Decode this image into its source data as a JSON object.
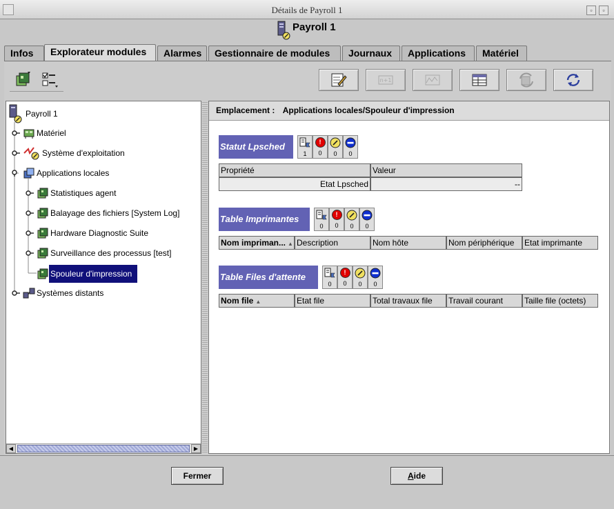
{
  "window": {
    "title": "Détails de Payroll 1",
    "host_name": "Payroll 1"
  },
  "tabs": [
    {
      "label": "Infos"
    },
    {
      "label": "Explorateur modules"
    },
    {
      "label": "Alarmes"
    },
    {
      "label": "Gestionnaire de modules"
    },
    {
      "label": "Journaux"
    },
    {
      "label": "Applications"
    },
    {
      "label": "Matériel"
    }
  ],
  "active_tab": "Explorateur modules",
  "tree": {
    "root": "Payroll 1",
    "items": [
      {
        "label": "Matériel"
      },
      {
        "label": "Système d'exploitation"
      },
      {
        "label": "Applications locales"
      },
      {
        "label": "Statistiques agent"
      },
      {
        "label": "Balayage des fichiers [System Log]"
      },
      {
        "label": "Hardware Diagnostic Suite"
      },
      {
        "label": "Surveillance des processus [test]"
      },
      {
        "label": "Spouleur d'impression"
      },
      {
        "label": "Systèmes distants"
      }
    ],
    "selected": "Spouleur d'impression"
  },
  "location": {
    "label": "Emplacement :",
    "value": "Applications locales/Spouleur d'impression"
  },
  "sections": [
    {
      "title": "Statut Lpsched",
      "counts": [
        "1",
        "0",
        "0",
        "0"
      ],
      "columns": [
        "Propriété",
        "Valeur"
      ],
      "rows": [
        [
          "Etat Lpsched",
          "--"
        ]
      ]
    },
    {
      "title": "Table Imprimantes",
      "counts": [
        "0",
        "0",
        "0",
        "0"
      ],
      "columns": [
        "Nom impriman...",
        "Description",
        "Nom hôte",
        "Nom périphérique",
        "Etat imprimante"
      ]
    },
    {
      "title": "Table Files d'attente",
      "counts": [
        "0",
        "0",
        "0",
        "0"
      ],
      "columns": [
        "Nom file",
        "Etat file",
        "Total travaux file",
        "Travail courant",
        "Taille file (octets)"
      ]
    }
  ],
  "buttons": {
    "close": "Fermer",
    "help_mnemonic": "A",
    "help_rest": "ide"
  },
  "colors": {
    "selection": "#10107a",
    "section_header": "#6262b4",
    "critical": "#e00000",
    "warning": "#f0e060",
    "disabled_state": "#1030d0"
  }
}
